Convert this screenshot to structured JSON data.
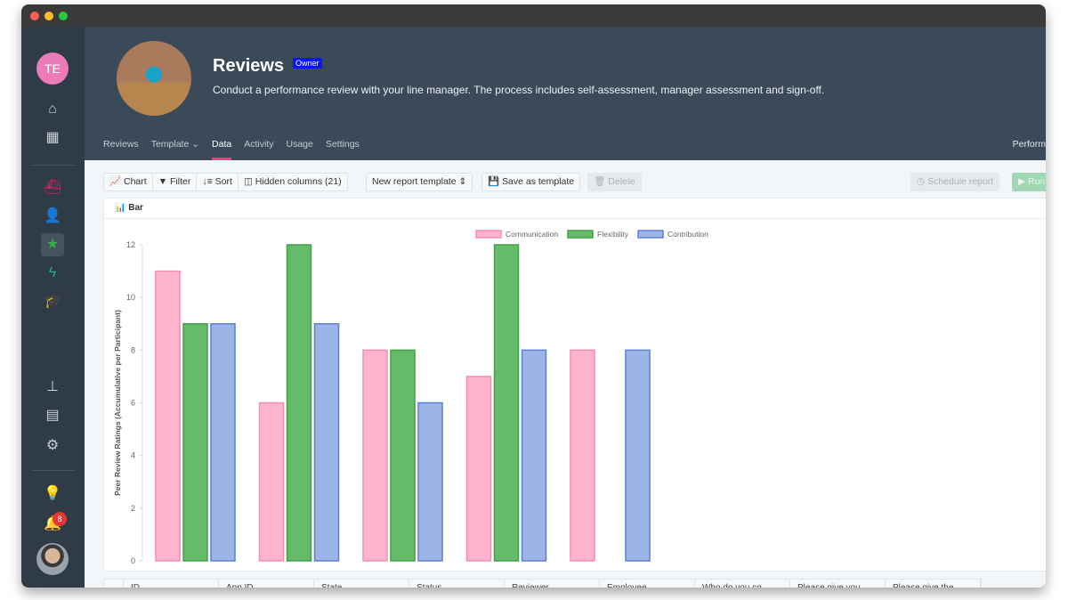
{
  "window": {
    "traffic_lights": [
      "#fe5f57",
      "#febc2e",
      "#28c840"
    ]
  },
  "sidebar": {
    "user_initials": "TE",
    "notification_count": "8",
    "items": [
      {
        "icon": "home-icon"
      },
      {
        "icon": "grid-icon"
      },
      {
        "icon": "ship-icon",
        "color": "#e91e63"
      },
      {
        "icon": "user-edit-icon",
        "color": "#f0a500"
      },
      {
        "icon": "star-icon",
        "color": "#2fb344",
        "active": true
      },
      {
        "icon": "bolt-icon",
        "color": "#1ab394"
      },
      {
        "icon": "graduation-cap-icon",
        "color": "#b05cc6"
      },
      {
        "icon": "sitemap-icon"
      },
      {
        "icon": "table-icon"
      },
      {
        "icon": "gear-icon"
      },
      {
        "icon": "lightbulb-icon"
      },
      {
        "icon": "bell-icon"
      }
    ]
  },
  "header": {
    "title": "Reviews",
    "badge": "Owner",
    "description": "Conduct a performance review with your line manager. The process includes self-assessment, manager assessment and sign-off.",
    "right_label": "Perform",
    "tabs": [
      {
        "label": "Reviews"
      },
      {
        "label": "Template"
      },
      {
        "label": "Data",
        "active": true
      },
      {
        "label": "Activity"
      },
      {
        "label": "Usage"
      },
      {
        "label": "Settings"
      }
    ]
  },
  "toolbar": {
    "chart": "Chart",
    "filter": "Filter",
    "sort": "Sort",
    "hidden_columns": "Hidden columns (21)",
    "report_template": "New report template",
    "save_template": "Save as template",
    "delete": "Delete",
    "schedule": "Schedule report",
    "run": "Run"
  },
  "panel": {
    "title": "Bar"
  },
  "chart_data": {
    "type": "bar",
    "ylabel": "Peer Review Ratings (Accumulative per Participant)",
    "ylim": [
      0,
      12
    ],
    "yticks": [
      0,
      2,
      4,
      6,
      8,
      10,
      12
    ],
    "grid": false,
    "legend": "top-center",
    "series": [
      {
        "name": "Communication",
        "color": "#f48fb1",
        "fill": "#ffb3cf",
        "values": [
          11,
          6,
          8,
          7,
          8
        ]
      },
      {
        "name": "Flexibility",
        "color": "#43a047",
        "fill": "#66bb6a",
        "values": [
          9,
          12,
          8,
          12,
          0
        ]
      },
      {
        "name": "Contribution",
        "color": "#5c7fd6",
        "fill": "#9db4e6",
        "values": [
          9,
          9,
          6,
          8,
          8
        ]
      }
    ]
  },
  "table": {
    "columns": [
      "ID",
      "App ID",
      "State",
      "Status",
      "Reviewer",
      "Employee",
      "Who do you co",
      "Please give you",
      "Please give the"
    ]
  }
}
